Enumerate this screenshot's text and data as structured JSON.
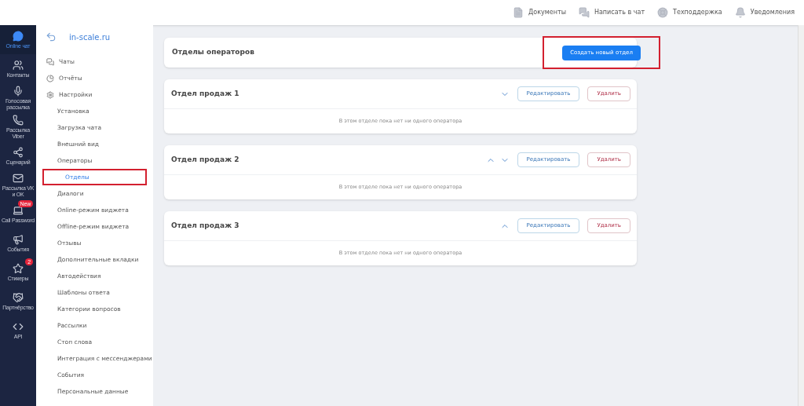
{
  "top_bar": {
    "links": [
      {
        "kind": "docs",
        "label": "Документы"
      },
      {
        "kind": "chat",
        "label": "Написать в чат"
      },
      {
        "kind": "support",
        "label": "Техподдержка"
      },
      {
        "kind": "bell",
        "label": "Уведомления"
      }
    ]
  },
  "rail": [
    {
      "kind": "chat",
      "label": "Online чат",
      "selected": true
    },
    {
      "kind": "contacts",
      "label": "Контакты",
      "selected": false
    },
    {
      "kind": "mic",
      "label": "Голосовая рассылка",
      "selected": false
    },
    {
      "kind": "viber",
      "label": "Рассылка Viber",
      "selected": false
    },
    {
      "kind": "scenario",
      "label": "Сценарий",
      "selected": false
    },
    {
      "kind": "vk",
      "label": "Рассылка VK и OK",
      "selected": false
    },
    {
      "kind": "laptop",
      "label": "Call Password",
      "selected": false,
      "badge": "New"
    },
    {
      "kind": "megaphone",
      "label": "События",
      "selected": false
    },
    {
      "kind": "star",
      "label": "Стикеры",
      "selected": false,
      "badge": "2"
    },
    {
      "kind": "handshake",
      "label": "Партнёрство",
      "selected": false
    },
    {
      "kind": "code",
      "label": "API",
      "selected": false
    }
  ],
  "sidebar": {
    "site": "in-scale.ru",
    "items": [
      {
        "kind": "chats",
        "label": "Чаты",
        "selected": false,
        "highlighted": false
      },
      {
        "kind": "reports",
        "label": "Отчёты",
        "selected": false,
        "highlighted": false
      },
      {
        "kind": "settings",
        "label": "Настройки",
        "selected": false,
        "highlighted": false,
        "children": [
          {
            "label": "Установка",
            "selected": false,
            "highlighted": false
          },
          {
            "label": "Загрузка чата",
            "selected": false,
            "highlighted": false
          },
          {
            "label": "Внешний вид",
            "selected": false,
            "highlighted": false
          },
          {
            "label": "Операторы",
            "selected": false,
            "highlighted": false
          },
          {
            "label": "Отделы",
            "selected": true,
            "highlighted": true
          },
          {
            "label": "Диалоги",
            "selected": false,
            "highlighted": false
          },
          {
            "label": "Online-режим виджета",
            "selected": false,
            "highlighted": false
          },
          {
            "label": "Offline-режим виджета",
            "selected": false,
            "highlighted": false
          },
          {
            "label": "Отзывы",
            "selected": false,
            "highlighted": false
          },
          {
            "label": "Дополнительные вкладки",
            "selected": false,
            "highlighted": false
          },
          {
            "label": "Автодействия",
            "selected": false,
            "highlighted": false
          },
          {
            "label": "Шаблоны ответа",
            "selected": false,
            "highlighted": false
          },
          {
            "label": "Категории вопросов",
            "selected": false,
            "highlighted": false
          },
          {
            "label": "Рассылки",
            "selected": false,
            "highlighted": false
          },
          {
            "label": "Стоп слова",
            "selected": false,
            "highlighted": false
          },
          {
            "label": "Интеграция с мессенджерами",
            "selected": false,
            "highlighted": false
          },
          {
            "label": "События",
            "selected": false,
            "highlighted": false
          },
          {
            "label": "Персональные данные",
            "selected": false,
            "highlighted": false
          }
        ]
      }
    ]
  },
  "header": {
    "title": "Отделы операторов",
    "create_button": {
      "label": "Создать новый отдел",
      "highlighted": true
    }
  },
  "departments": [
    {
      "name": "Отдел продаж 1",
      "move_up": false,
      "move_down": true,
      "edit": "Редактировать",
      "delete": "Удалить",
      "empty": "В этом отделе пока нет ни одного оператора"
    },
    {
      "name": "Отдел продаж 2",
      "move_up": true,
      "move_down": true,
      "edit": "Редактировать",
      "delete": "Удалить",
      "empty": "В этом отделе пока нет ни одного оператора"
    },
    {
      "name": "Отдел продаж 3",
      "move_up": true,
      "move_down": false,
      "edit": "Редактировать",
      "delete": "Удалить",
      "empty": "В этом отделе пока нет ни одного оператора"
    }
  ]
}
